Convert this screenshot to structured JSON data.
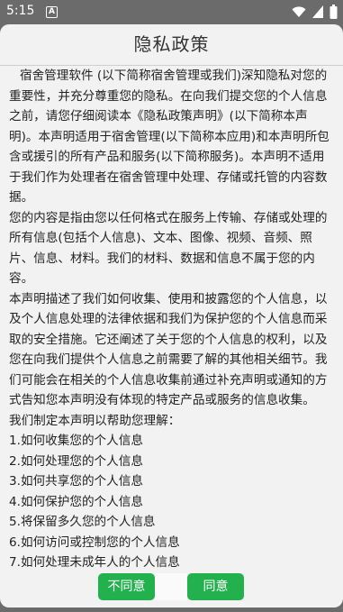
{
  "status_bar": {
    "time": "5:15",
    "notification_badge": "A",
    "icons": [
      "wifi-icon",
      "cell-signal-icon",
      "battery-icon"
    ]
  },
  "dialog": {
    "title": "隐私政策",
    "paragraphs": [
      "宿舍管理软件 (以下简称宿舍管理或我们)深知隐私对您的重要性，并充分尊重您的隐私。在向我们提交您的个人信息之前，请您仔细阅读本《隐私政策声明》(以下简称本声明)。本声明适用于宿舍管理(以下简称本应用)和本声明所包含或援引的所有产品和服务(以下简称服务)。本声明不适用于我们作为处理者在宿舍管理中处理、存储或托管的内容数据。",
      "您的内容是指由您以任何格式在服务上传输、存储或处理的所有信息(包括个人信息)、文本、图像、视频、音频、照片、信息、材料。我们的材料、数据和信息不属于您的内容。",
      "本声明描述了我们如何收集、使用和披露您的个人信息，以及个人信息处理的法律依据和我们为保护您的个人信息而采取的安全措施。它还阐述了关于您的个人信息的权利，以及您在向我们提供个人信息之前需要了解的其他相关细节。我们可能会在相关的个人信息收集前通过补充声明或通知的方式告知您本声明没有体现的特定产品或服务的信息收集。",
      "我们制定本声明以帮助您理解：",
      "1.如何收集您的个人信息",
      "2.如何处理您的个人信息",
      "3.如何共享您的个人信息",
      "4.如何保护您的个人信息",
      "5.将保留多久您的个人信息",
      "6.如何访问或控制您的个人信息",
      "7.如何处理未成年人的个人信息"
    ],
    "buttons": {
      "decline": "不同意",
      "agree": "同意"
    }
  },
  "colors": {
    "scrim": "#6b6b6b",
    "dialog_bg": "#f2f2f2",
    "button_green": "#22b14c"
  }
}
